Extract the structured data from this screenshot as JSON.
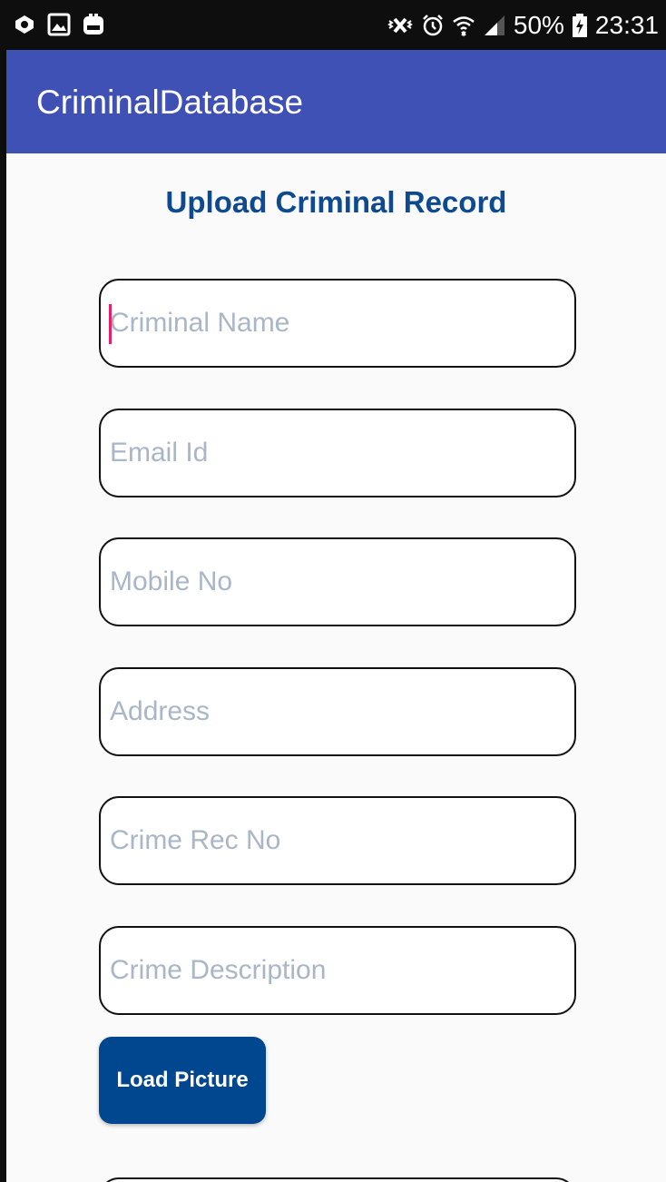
{
  "status_bar": {
    "battery": "50%",
    "time": "23:31",
    "left_icons": [
      "photo-sync-icon",
      "gallery-icon",
      "backup-icon"
    ],
    "right_icons": [
      "vibrate-mute-icon",
      "alarm-icon",
      "wifi-icon",
      "signal-icon",
      "battery-charging-icon"
    ]
  },
  "app_bar": {
    "title": "CriminalDatabase",
    "color": "#3f51b5"
  },
  "form": {
    "title": "Upload Criminal Record",
    "title_color": "#0d4a8f",
    "fields": [
      {
        "name": "criminal-name",
        "placeholder": "Criminal Name",
        "value": ""
      },
      {
        "name": "email-id",
        "placeholder": "Email Id",
        "value": ""
      },
      {
        "name": "mobile-no",
        "placeholder": "Mobile No",
        "value": ""
      },
      {
        "name": "address",
        "placeholder": "Address",
        "value": ""
      },
      {
        "name": "crime-rec-no",
        "placeholder": "Crime Rec No",
        "value": ""
      },
      {
        "name": "crime-description",
        "placeholder": "Crime Description",
        "value": ""
      }
    ],
    "load_picture_label": "Load Picture",
    "button_color": "#004790",
    "cursor_color": "#e91e63"
  }
}
